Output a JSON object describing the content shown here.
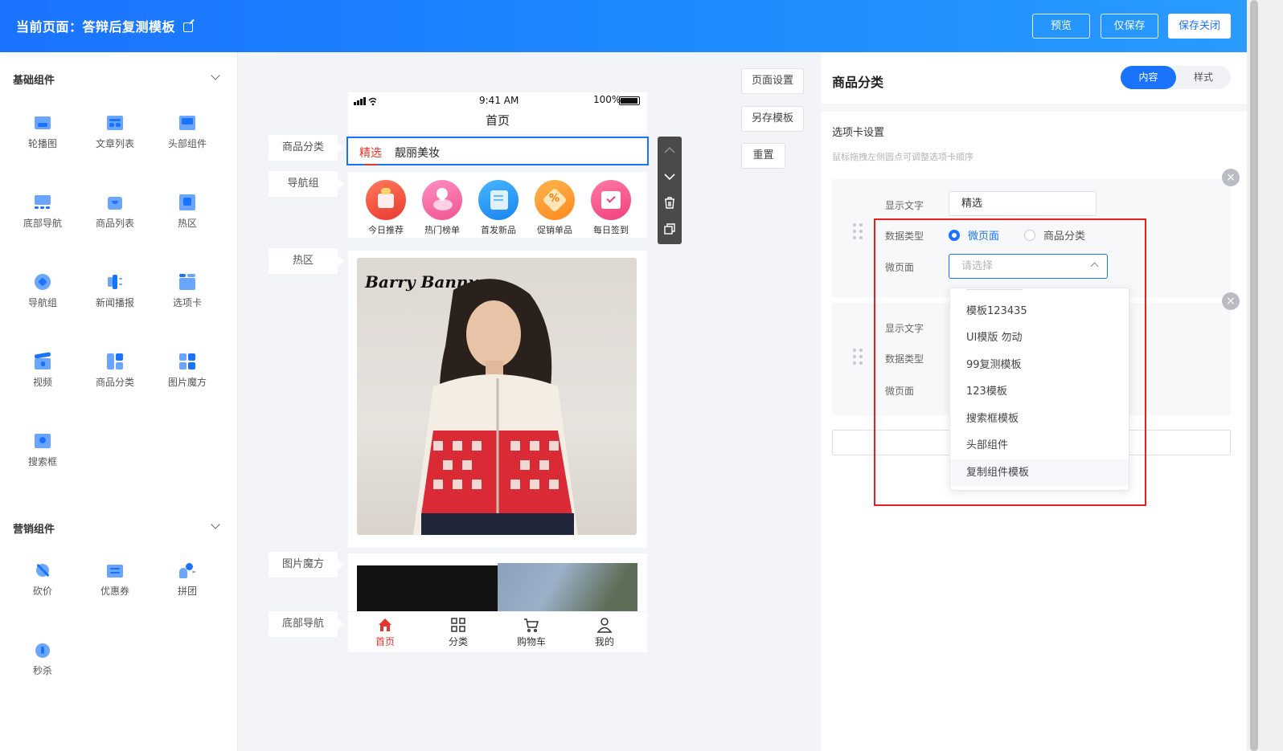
{
  "header": {
    "title": "当前页面：答辩后复测模板",
    "buttons": {
      "preview": "预览",
      "save_only": "仅保存",
      "save_close": "保存关闭"
    }
  },
  "left_panel": {
    "basic_section": "基础组件",
    "basic_items": [
      "轮播图",
      "文章列表",
      "头部组件",
      "底部导航",
      "商品列表",
      "热区",
      "导航组",
      "新闻播报",
      "选项卡",
      "视频",
      "商品分类",
      "图片魔方",
      "搜索框"
    ],
    "marketing_section": "营销组件",
    "marketing_items": [
      "砍价",
      "优惠券",
      "拼团",
      "秒杀"
    ]
  },
  "canvas": {
    "side_tags": {
      "category": "商品分类",
      "nav_group": "导航组",
      "hot_zone": "热区",
      "cube": "图片魔方",
      "bottom_nav": "底部导航"
    },
    "right_buttons": {
      "page_settings": "页面设置",
      "save_template": "另存模板",
      "reset": "重置"
    },
    "phone": {
      "time": "9:41 AM",
      "battery": "100%",
      "page_title": "首页",
      "tabs": [
        "精选",
        "靓丽美妆"
      ],
      "nav_items": [
        "今日推荐",
        "热门榜单",
        "首发新品",
        "促销单品",
        "每日签到"
      ],
      "banner_brand": "Barry Banny",
      "bottom_nav": [
        "首页",
        "分类",
        "购物车",
        "我的"
      ]
    }
  },
  "right_panel": {
    "title": "商品分类",
    "tabs": {
      "content": "内容",
      "style": "样式"
    },
    "subtitle": "选项卡设置",
    "hint": "鼠标拖拽左侧圆点可调整选项卡顺序",
    "labels": {
      "display_text": "显示文字",
      "data_type": "数据类型",
      "micro_page": "微页面"
    },
    "card1": {
      "display_text_value": "精选",
      "radio_micro": "微页面",
      "radio_category": "商品分类",
      "select_placeholder": "请选择"
    },
    "dropdown_options": [
      "模板123435",
      "UI模版 勿动",
      "99复测模板",
      "123模板",
      "搜索框模板",
      "头部组件",
      "复制组件模板"
    ],
    "close_symbol": "×"
  },
  "colors": {
    "primary": "#1a73ff",
    "accent_red": "#e5362e",
    "highlight_box": "#e61e1e"
  }
}
